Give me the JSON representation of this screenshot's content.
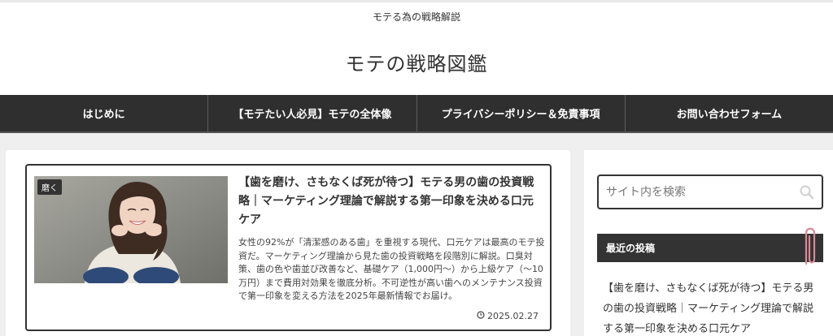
{
  "header": {
    "tagline": "モテる為の戦略解説",
    "site_title": "モテの戦略図鑑"
  },
  "nav": {
    "items": [
      {
        "label": "はじめに"
      },
      {
        "label": "【モテたい人必見】モテの全体像"
      },
      {
        "label": "プライバシーポリシー＆免責事項"
      },
      {
        "label": "お問い合わせフォーム"
      }
    ]
  },
  "main": {
    "article": {
      "category": "磨く",
      "title": "【歯を磨け、さもなくば死が待つ】モテる男の歯の投資戦略｜マーケティング理論で解説する第一印象を決める口元ケア",
      "excerpt": "女性の92%が「清潔感のある歯」を重視する現代、口元ケアは最高のモテ投資だ。マーケティング理論から見た歯の投資戦略を段階別に解説。口臭対策、歯の色や歯並び改善など、基礎ケア（1,000円〜）から上級ケア（〜10万円）まで費用対効果を徹底分析。不可逆性が高い歯へのメンテナンス投資で第一印象を変える方法を2025年最新情報でお届け。",
      "date": "2025.02.27",
      "date_icon": "clock-icon"
    }
  },
  "sidebar": {
    "search": {
      "placeholder": "サイト内を検索",
      "icon": "search-icon"
    },
    "recent": {
      "heading": "最近の投稿",
      "posts": [
        {
          "title": "【歯を磨け、さもなくば死が待つ】モテる男の歯の投資戦略｜マーケティング理論で解説する第一印象を決める口元ケア"
        }
      ]
    }
  },
  "colors": {
    "nav_bg": "#2f2f2f",
    "page_bg": "#efefef",
    "text": "#333333",
    "clip": "#d98a96"
  }
}
